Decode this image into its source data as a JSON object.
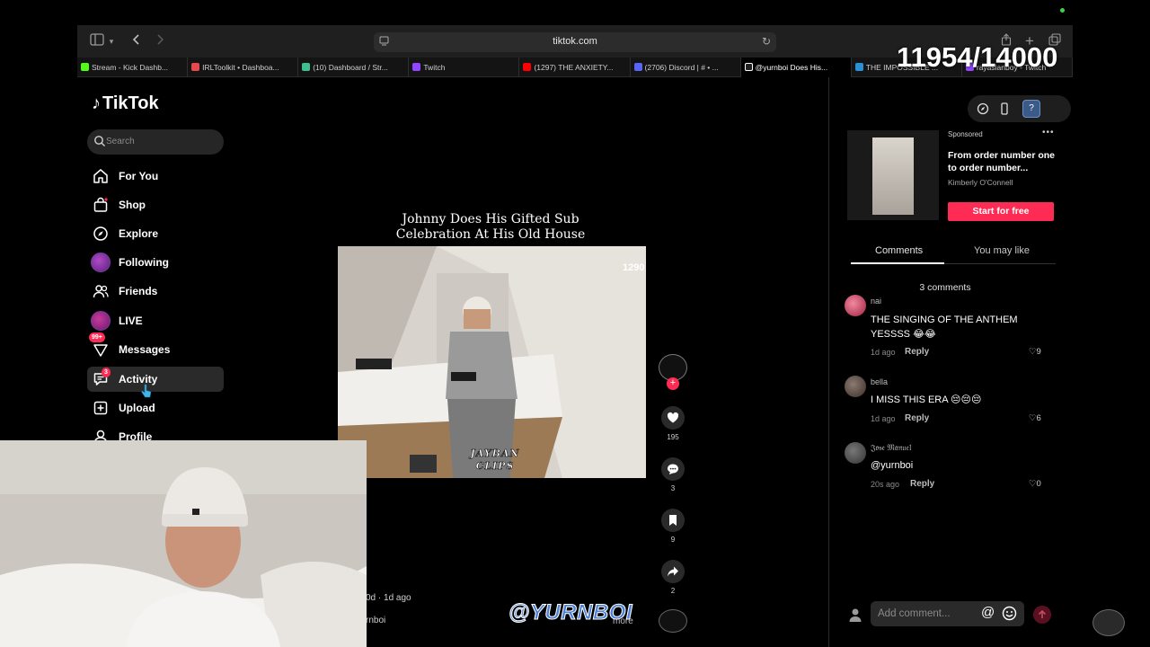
{
  "browser": {
    "url": "tiktok.com",
    "tabs": [
      {
        "label": "Stream - Kick Dashb...",
        "color": "#53fc18"
      },
      {
        "label": "IRLToolkit • Dashboa...",
        "color": "#e5484d"
      },
      {
        "label": "(10) Dashboard / Str...",
        "color": "#3fbf8f"
      },
      {
        "label": "Twitch",
        "color": "#9146ff"
      },
      {
        "label": "(1297) THE ANXIETY...",
        "color": "#ff0000"
      },
      {
        "label": "(2706) Discord | # • ...",
        "color": "#5865f2"
      },
      {
        "label": "@yurnboi Does His...",
        "color": "#ffffff"
      },
      {
        "label": "THE IMPOSSIBLE ...",
        "color": "#2b8fd6"
      },
      {
        "label": "rayasianboy - Twitch",
        "color": "#9146ff"
      }
    ],
    "active_tab_index": 6
  },
  "sidebar": {
    "logo": "TikTok",
    "search_placeholder": "Search",
    "items": [
      {
        "label": "For You",
        "icon": "home-icon"
      },
      {
        "label": "Shop",
        "icon": "shop-icon"
      },
      {
        "label": "Explore",
        "icon": "compass-icon"
      },
      {
        "label": "Following",
        "icon": "avatar-icon"
      },
      {
        "label": "Friends",
        "icon": "friends-icon"
      },
      {
        "label": "LIVE",
        "icon": "live-icon"
      },
      {
        "label": "Messages",
        "icon": "messages-icon",
        "badge": "99+"
      },
      {
        "label": "Activity",
        "icon": "activity-icon",
        "badge": "3"
      },
      {
        "label": "Upload",
        "icon": "upload-icon"
      },
      {
        "label": "Profile",
        "icon": "profile-icon"
      }
    ]
  },
  "video": {
    "title_line1": "Johnny Does His Gifted Sub",
    "title_line2": "Celebration At His Old House",
    "overlay_counter": "1290",
    "watermark_line1": "JAYBAN",
    "watermark_line2": "CLIPS",
    "meta_date": "0d · 1d ago",
    "meta_user": "rnboi",
    "meta_more": "more"
  },
  "actions": {
    "likes": "195",
    "comments": "3",
    "saves": "9",
    "shares": "2"
  },
  "ad": {
    "sponsored": "Sponsored",
    "text": "From order number one to order number...",
    "author": "Kimberly O'Connell",
    "cta": "Start for free"
  },
  "panel_tabs": {
    "comments": "Comments",
    "you_may_like": "You may like"
  },
  "comments": {
    "count_label": "3 comments",
    "items": [
      {
        "user": "nai",
        "text": "THE SINGING OF THE ANTHEM YESSSS 😂😂",
        "time": "1d ago",
        "reply": "Reply",
        "likes": "9"
      },
      {
        "user": "bella",
        "text": "I MISS THIS ERA 😔😔😔",
        "time": "1d ago",
        "reply": "Reply",
        "likes": "6"
      },
      {
        "user": "𝔍𝔬𝔰𝔢 𝔐𝔞𝔫𝔲𝔢𝔩",
        "text": "@yurnboi",
        "time": "20s ago",
        "reply": "Reply",
        "likes": "0"
      }
    ],
    "add_placeholder": "Add comment...",
    "at_symbol": "@"
  },
  "overlay": {
    "counter": "11954/14000",
    "brand": "@YURNBOI"
  },
  "colors": {
    "accent": "#fe2c55",
    "bg": "#000000",
    "panel": "#2a2a2a"
  }
}
